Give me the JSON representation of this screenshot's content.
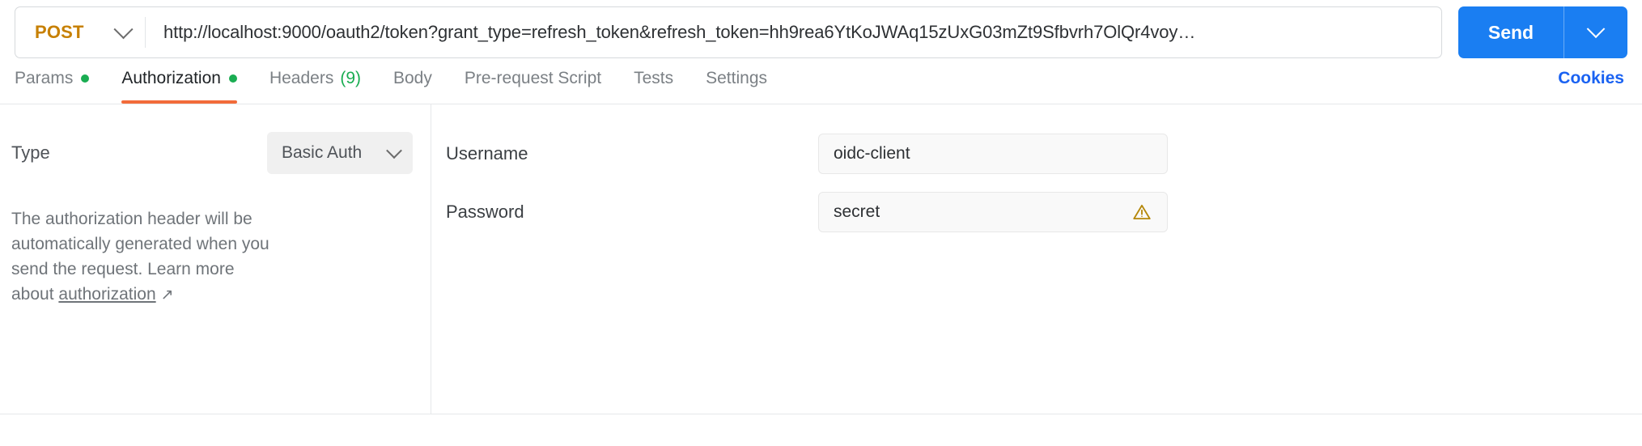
{
  "request_bar": {
    "method": "POST",
    "method_caret_icon": "chevron-down-icon",
    "url": "http://localhost:9000/oauth2/token?grant_type=refresh_token&refresh_token=hh9rea6YtKoJWAq15zUxG03mZt9Sfbvrh7OlQr4voy…",
    "url_placeholder": "Enter URL or paste text",
    "send_label": "Send",
    "send_caret_icon": "chevron-down-icon",
    "send_color": "#1a7ef2",
    "method_color": "#c78000"
  },
  "tabs": [
    {
      "label": "Params",
      "indicator": "dot",
      "active": false
    },
    {
      "label": "Authorization",
      "indicator": "dot",
      "active": true
    },
    {
      "label": "Headers",
      "count": "(9)",
      "indicator": "count",
      "active": false
    },
    {
      "label": "Body",
      "indicator": "none",
      "active": false
    },
    {
      "label": "Pre-request Script",
      "indicator": "none",
      "active": false
    },
    {
      "label": "Tests",
      "indicator": "none",
      "active": false
    },
    {
      "label": "Settings",
      "indicator": "none",
      "active": false
    }
  ],
  "tab_accent_color": "#f26b3a",
  "tab_dot_color": "#1aad52",
  "cookies": {
    "label": "Cookies",
    "color": "#1a62f2"
  },
  "auth_panel": {
    "type_label": "Type",
    "type_value": "Basic Auth",
    "type_caret_icon": "chevron-down-icon",
    "help_text": "The authorization header will be automatically generated when you send the request. Learn more about ",
    "help_link_text": "authorization",
    "help_link_icon": "external-link-arrow-icon",
    "help_link_glyph": "↗"
  },
  "credentials": {
    "fields": [
      {
        "label": "Username",
        "value": "oidc-client",
        "placeholder": "Username",
        "warning": false
      },
      {
        "label": "Password",
        "value": "secret",
        "placeholder": "Password",
        "warning": true,
        "warning_icon": "warning-triangle-icon",
        "warning_color": "#b5880b"
      }
    ]
  }
}
